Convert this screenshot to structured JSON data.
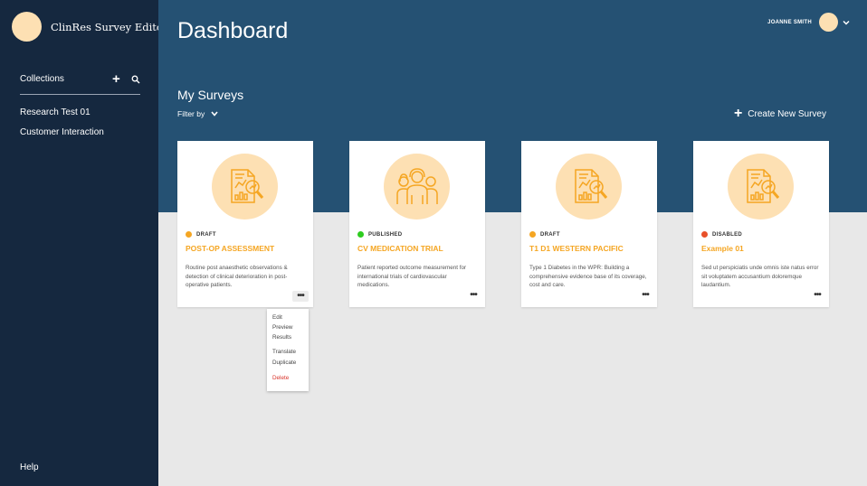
{
  "app": {
    "name": "ClinRes Survey Editor"
  },
  "sidebar": {
    "collections_label": "Collections",
    "add_icon": "plus-icon",
    "search_icon": "search-icon",
    "items": [
      {
        "label": "Research Test 01"
      },
      {
        "label": "Customer Interaction"
      }
    ],
    "help_label": "Help"
  },
  "header": {
    "title": "Dashboard",
    "user_name": "JOANNE SMITH"
  },
  "main": {
    "section_title": "My Surveys",
    "filter_label": "Filter by",
    "create_label": "Create New Survey"
  },
  "colors": {
    "sidebar": "#15283f",
    "header": "#255173",
    "accent": "#f5a623",
    "icon_bg": "#fde0b3",
    "draft": "#f5a623",
    "published": "#2ecc1f",
    "disabled": "#e8502a"
  },
  "cards": [
    {
      "status": "DRAFT",
      "status_color": "#f5a623",
      "title": "POST-OP ASSESSMENT",
      "description": "Routine post anaesthetic observations & detection of clinical deterioration in post-operative patients.",
      "icon": "report-magnifier-icon"
    },
    {
      "status": "PUBLISHED",
      "status_color": "#2ecc1f",
      "title": "CV MEDICATION TRIAL",
      "description": "Patient reported outcome measurement for international trials of cardiovascular medications.",
      "icon": "people-group-icon"
    },
    {
      "status": "DRAFT",
      "status_color": "#f5a623",
      "title": "T1 D1 WESTERN PACIFIC",
      "description": "Type 1 Diabetes in the WPR: Building a comprehensive evidence base of its coverage, cost and care.",
      "icon": "report-magnifier-icon"
    },
    {
      "status": "DISABLED",
      "status_color": "#e8502a",
      "title": "Example 01",
      "description": "Sed ut perspiciatis unde omnis iste natus error sit voluptatem accusantium doloremque laudantium.",
      "icon": "report-magnifier-icon"
    }
  ],
  "card_menu": {
    "items": [
      "Edit",
      "Preview",
      "Results",
      "Translate",
      "Duplicate",
      "Delete"
    ]
  }
}
